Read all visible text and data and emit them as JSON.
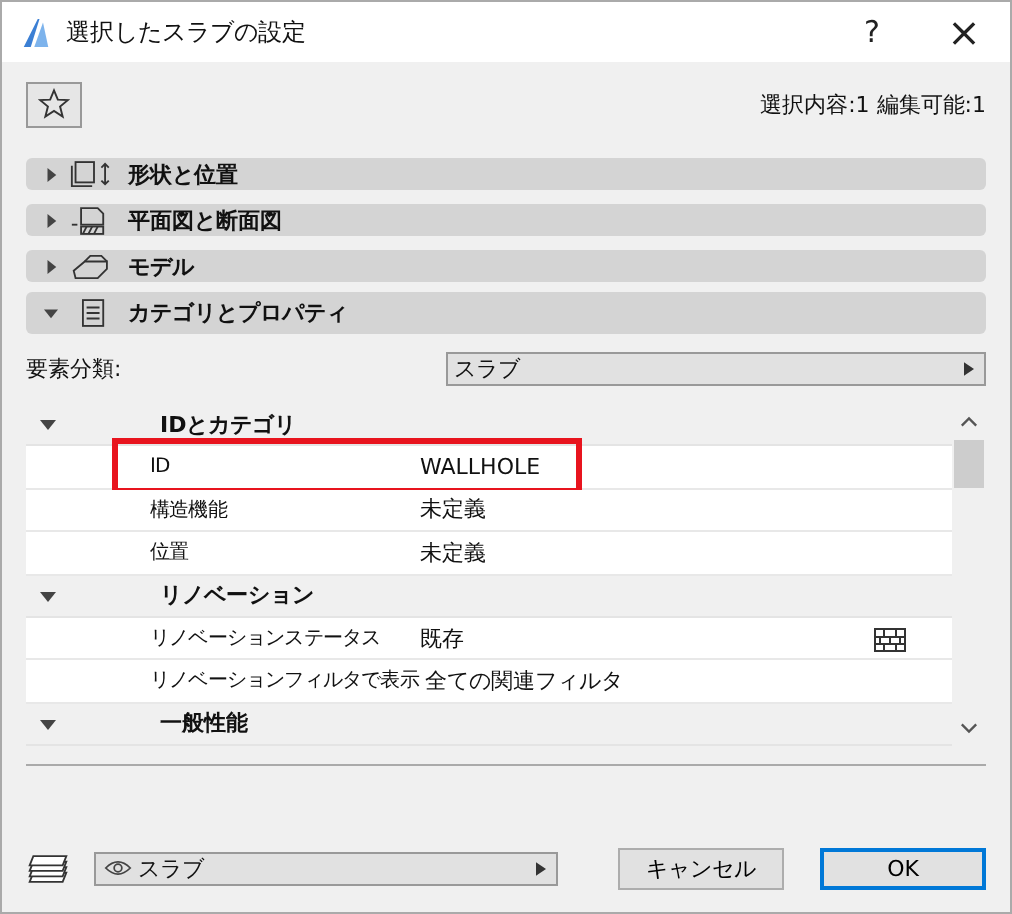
{
  "window": {
    "title": "選択したスラブの設定",
    "help": "?",
    "close": "×"
  },
  "selection_info": "選択内容:1 編集可能:1",
  "sections": [
    {
      "label": "形状と位置",
      "expanded": false,
      "kind": "shape"
    },
    {
      "label": "平面図と断面図",
      "expanded": false,
      "kind": "plan"
    },
    {
      "label": "モデル",
      "expanded": false,
      "kind": "model"
    },
    {
      "label": "カテゴリとプロパティ",
      "expanded": true,
      "kind": "props"
    }
  ],
  "classification": {
    "label": "要素分類:",
    "value": "スラブ"
  },
  "tree": [
    {
      "label": "IDとカテゴリ",
      "expanded": true,
      "children": [
        {
          "name": "ID",
          "value": "WALLHOLE",
          "highlighted": true,
          "kind": "plain"
        },
        {
          "name": "構造機能",
          "value": "未定義",
          "highlighted": false,
          "kind": "plain"
        },
        {
          "name": "位置",
          "value": "未定義",
          "highlighted": false,
          "kind": "plain"
        }
      ]
    },
    {
      "label": "リノベーション",
      "expanded": true,
      "children": [
        {
          "name": "リノベーションステータス",
          "value": "既存",
          "highlighted": false,
          "kind": "status"
        },
        {
          "name": "リノベーションフィルタで表示",
          "value": "全ての関連フィルタ",
          "highlighted": false,
          "kind": "plain"
        }
      ]
    },
    {
      "label": "一般性能",
      "expanded": true
    }
  ],
  "footer": {
    "layer": "スラブ",
    "cancel": "キャンセル",
    "ok": "OK"
  }
}
